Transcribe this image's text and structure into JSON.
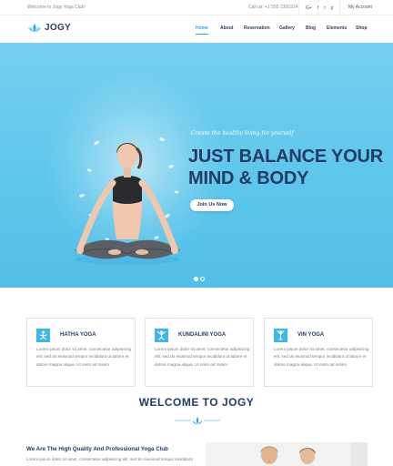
{
  "topbar": {
    "welcome": "Welcome to Jogy Yoga Club!",
    "call_us": "Call us: +1 555 2300314",
    "socials": [
      "G+",
      "f",
      "t",
      "p"
    ],
    "account": "My Account"
  },
  "header": {
    "logo_text": "JOGY",
    "nav": [
      "Home",
      "About",
      "Reservation",
      "Gallery",
      "Blog",
      "Elements",
      "Shop"
    ],
    "active_nav": "Home"
  },
  "hero": {
    "tagline": "Create the healthy living for yourself",
    "title_line1": "JUST BALANCE YOUR",
    "title_line2": "MIND & BODY",
    "button": "Join Us Now",
    "slides_total": 2,
    "slide_active": 1
  },
  "features": [
    {
      "title": "HATHA YOGA",
      "text": "Lorem ipsum dolor sit amet, consectetur adipisicing elit, sed do eiusmod tempor incididunt ut labore et dolore magna aliqua. Ut enim ad minim",
      "icon": "yoga-pose-icon"
    },
    {
      "title": "KUNDALINI YOGA",
      "text": "Lorem ipsum dolor sit amet, consectetur adipisicing elit, sed do eiusmod tempor incididunt ut labore et dolore magna aliqua. Ut enim ad minim",
      "icon": "yoga-pose-icon"
    },
    {
      "title": "VIN YOGA",
      "text": "Lorem ipsum dolor sit amet, consectetur adipisicing elit, sed do eiusmod tempor incididunt ut labore et dolore magna aliqua. Ut enim ad minim",
      "icon": "yoga-pose-icon"
    }
  ],
  "welcome": {
    "title": "WELCOME TO JOGY"
  },
  "about": {
    "heading": "We Are The High Quality And Professional Yoga Club",
    "text": "Lorem ipsum dolor sit amet, consectetur adipisicing elit, sed do eiusmod tempor incididunt"
  },
  "colors": {
    "accent": "#2aa7e0",
    "navy": "#233b63",
    "hero_bg": "#5ec6ec"
  }
}
